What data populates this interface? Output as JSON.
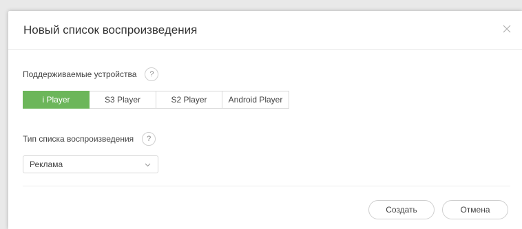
{
  "dialog": {
    "title": "Новый список воспроизведения"
  },
  "devices": {
    "label": "Поддерживаемые устройства",
    "help": "?",
    "options": [
      {
        "label": "i Player",
        "active": true
      },
      {
        "label": "S3 Player",
        "active": false
      },
      {
        "label": "S2 Player",
        "active": false
      },
      {
        "label": "Android Player",
        "active": false
      }
    ]
  },
  "playlist_type": {
    "label": "Тип списка воспроизведения",
    "help": "?",
    "selected": "Реклама"
  },
  "footer": {
    "create_label": "Создать",
    "cancel_label": "Отмена"
  },
  "colors": {
    "accent": "#6cb65a"
  }
}
